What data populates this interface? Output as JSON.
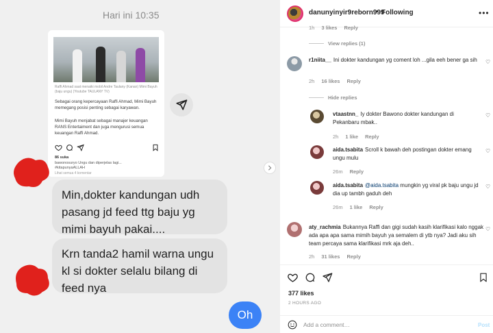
{
  "chat": {
    "time": "Hari ini 10:35",
    "shared_post": {
      "caption": "Raffi Ahmad saat menaiki mobil Andre Taulany (Kanan) Mimi Bayuh (baju ungu) (Youtube TAULANY TV)",
      "text1": "Sebagai orang kepercayaan Raffi Ahmad, Mimi Bayuh memegang posisi penting sebagai karyawan.",
      "text2": "Mimi Bayuh menjabat sebagai manajer keuangan RANS Entertaiment dan juga mengurusi semua keuangan Raffi Ahmad.",
      "likes": "86 suka",
      "user_line": "bawonosuryo Ungu dan diperjelas lagi...",
      "tags": "#kitapunyaALLAH",
      "comments_link": "Lihat semua 4 komentar"
    },
    "bubble1": "Min,dokter kandungan udh pasang jd feed ttg baju yg mimi bayuh pakai....",
    "bubble2": "Krn tanda2 hamil warna ungu kl si dokter selalu bilang di feed nya",
    "oh": "Oh"
  },
  "ig": {
    "username": "danunyinyir9reborn999",
    "separator": "•",
    "following": "Following",
    "more": "•••",
    "partial_meta": {
      "time": "1h",
      "likes": "3 likes",
      "reply": "Reply"
    },
    "view_replies": "View replies (1)",
    "hide_replies": "Hide replies",
    "comments": [
      {
        "user": "r1niita__",
        "text": "Ini dokter kandungan yg coment loh ...gila eeh bener ga sih",
        "time": "2h",
        "likes": "16 likes",
        "reply": "Reply"
      },
      {
        "user": "vtaastnn_",
        "text": "Iy dokter Bawono dokter kandungan di Pekanbaru mbak..",
        "time": "2h",
        "likes": "1 like",
        "reply": "Reply"
      },
      {
        "user": "aida.tsabita",
        "text": "Scroll k bawah deh postingan dokter emang ungu mulu",
        "time": "26m",
        "likes": "",
        "reply": "Reply"
      },
      {
        "user": "aida.tsabita",
        "mention": "@aida.tsabita",
        "text": "mungkin yg viral pk baju ungu jd dia up tambh gaduh deh",
        "time": "26m",
        "likes": "1 like",
        "reply": "Reply"
      },
      {
        "user": "aty_rachmia",
        "text": "Bukannya Raffi dan gigi sudah kasih klarifikasi kalo nggak ada apa apa sama mimih bayuh ya semalem di ytb nya? Jadi aku sih team percaya sama klarifikasi mrk aja deh..",
        "time": "2h",
        "likes": "31 likes",
        "reply": "Reply"
      }
    ],
    "likes_count": "377 likes",
    "time_ago": "2 HOURS AGO",
    "comment_placeholder": "Add a comment…",
    "post_label": "Post"
  },
  "colors": {
    "accent": "#0095f6",
    "chat_bubble": "#e3e3e3",
    "oh_bubble": "#3b82f6",
    "blob": "#e0211c"
  }
}
